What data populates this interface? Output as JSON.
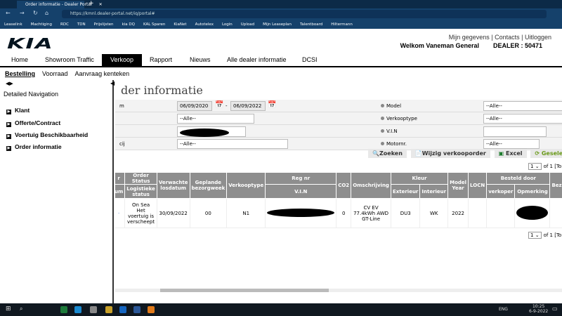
{
  "browser": {
    "tab_title": "Order informatie - Dealer Portal",
    "url": "https://kmnl.dealer-portal.net/iq/portal#",
    "bookmarks": [
      "Leaselink",
      "Machtiging",
      "RDC",
      "TDN",
      "Prijslijsten",
      "kia DQ",
      "KAL Sparen",
      "KiaNet",
      "Autotelex",
      "Login",
      "Upload",
      "Mijn Leaseplan",
      "Talentboard",
      "Hiltermann"
    ]
  },
  "header": {
    "logo": "KIA",
    "links": [
      "Mijn gegevens",
      "Contacts",
      "Uitloggen"
    ],
    "welcome": "Welkom Vaneman General",
    "dealer": "DEALER : 50471"
  },
  "menu": [
    "Home",
    "Showroom Traffic",
    "Verkoop",
    "Rapport",
    "Nieuws",
    "Alle dealer informatie",
    "DCSI"
  ],
  "submenu": [
    "Bestelling",
    "Voorraad",
    "Aanvraag kenteken"
  ],
  "sidebar": {
    "title": "Detailed Navigation",
    "items": [
      "Klant",
      "Offerte/Contract",
      "Voertuig Beschikbaarheid",
      "Order informatie"
    ]
  },
  "page_title": "der informatie",
  "filters": {
    "row1_label": "m",
    "date_from": "06/09/2020",
    "date_sep": "-",
    "date_to": "06/09/2022",
    "model_label": "Model",
    "model_value": "--Alle--",
    "row2_value": "--Alle--",
    "verkooptype_label": "Verkooptype",
    "verkooptype_value": "--Alle--",
    "vin_label": "V.I.N",
    "row4_label": "cij",
    "row4_value": "--Alle--",
    "motornr_label": "Motornr.",
    "motornr_value": "--Alle--"
  },
  "buttons": {
    "search": "Zoeken",
    "edit": "Wijzig verkooporder",
    "excel": "Excel",
    "selected": "Geselect"
  },
  "pager": {
    "page": "1",
    "of": "of 1 [To"
  },
  "table": {
    "headers_top": [
      "r",
      "Order Status",
      "Verwachte losdatum",
      "Geplande bezorgweek",
      "Verkooptype",
      "Reg nr",
      "CO2",
      "Omschrijving",
      "Kleur",
      "Model Year",
      "LOCN",
      "Besteld door",
      "Bez"
    ],
    "headers_bottom": [
      "um",
      "Logistieke status",
      "V.I.N",
      "Exterieur",
      "Interieur",
      "verkoper",
      "Opmerking"
    ],
    "rows": [
      {
        "status": "On Sea",
        "logistiek": "Het voertuig is verscheept",
        "losdatum": "30/09/2022",
        "bezorgweek": "00",
        "verkooptype": "N1",
        "co2": "0",
        "omschrijving": "CV EV 77.4kWh AWD GT-Line",
        "exterieur": "DU3",
        "interieur": "WK",
        "model_year": "2022"
      }
    ]
  },
  "taskbar": {
    "lang": "ENG",
    "time": "10:25",
    "date": "6-9-2022"
  }
}
